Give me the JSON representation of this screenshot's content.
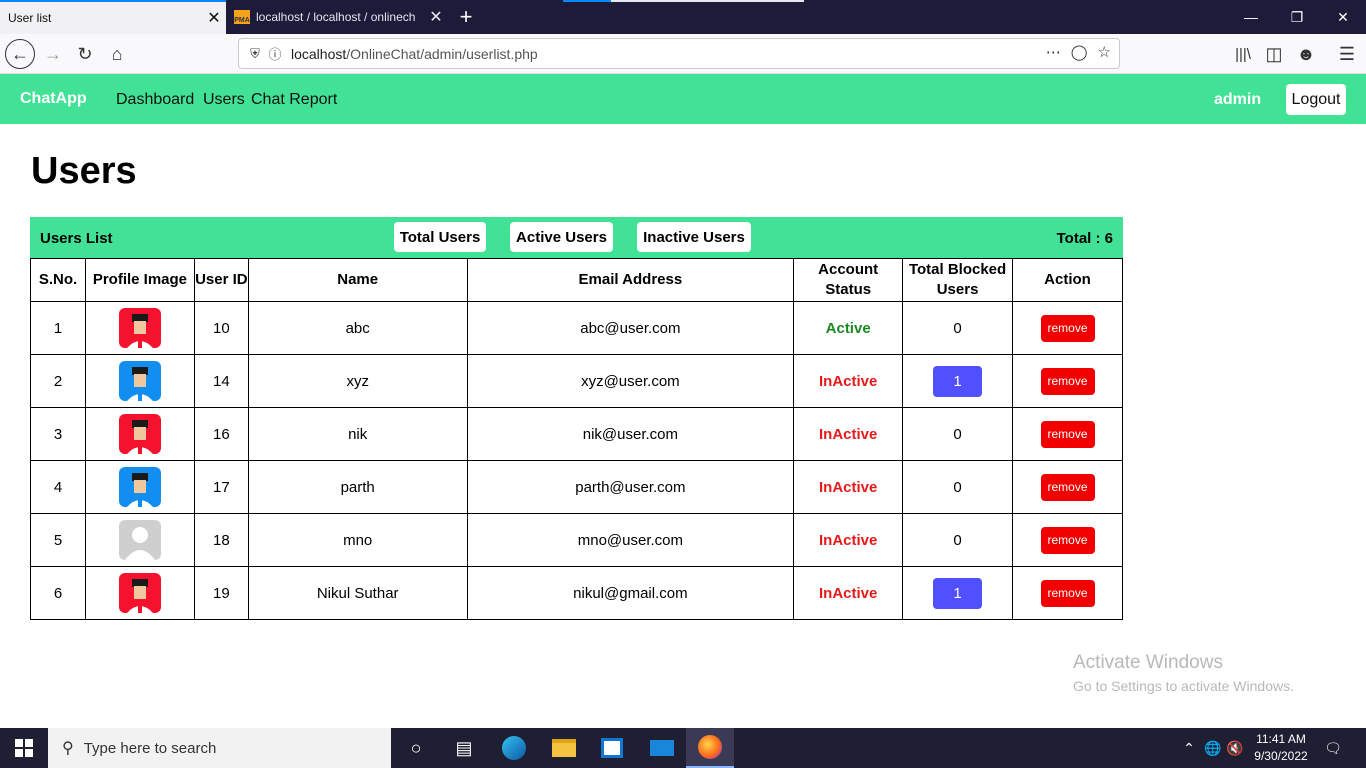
{
  "browser": {
    "tabs": [
      {
        "title": "User list",
        "active": true
      },
      {
        "title": "localhost / localhost / onlinech",
        "active": false
      }
    ],
    "url_host": "localhost",
    "url_path": "/OnlineChat/admin/userlist.php"
  },
  "nav": {
    "brand": "ChatApp",
    "links": [
      "Dashboard",
      "Users",
      "Chat Report"
    ],
    "user": "admin",
    "logout": "Logout"
  },
  "page": {
    "title": "Users",
    "list_title": "Users List",
    "filter_buttons": [
      "Total Users",
      "Active Users",
      "Inactive Users"
    ],
    "total": "Total : 6"
  },
  "table": {
    "headers": [
      "S.No.",
      "Profile Image",
      "User ID",
      "Name",
      "Email Address",
      "Account Status",
      "Total Blocked Users",
      "Action"
    ],
    "rows": [
      {
        "sno": "1",
        "avatar": "red",
        "user_id": "10",
        "name": "abc",
        "email": "abc@user.com",
        "status": "Active",
        "blocked": "0",
        "action": "remove"
      },
      {
        "sno": "2",
        "avatar": "blue",
        "user_id": "14",
        "name": "xyz",
        "email": "xyz@user.com",
        "status": "InActive",
        "blocked": "1",
        "action": "remove"
      },
      {
        "sno": "3",
        "avatar": "red",
        "user_id": "16",
        "name": "nik",
        "email": "nik@user.com",
        "status": "InActive",
        "blocked": "0",
        "action": "remove"
      },
      {
        "sno": "4",
        "avatar": "blue",
        "user_id": "17",
        "name": "parth",
        "email": "parth@user.com",
        "status": "InActive",
        "blocked": "0",
        "action": "remove"
      },
      {
        "sno": "5",
        "avatar": "default",
        "user_id": "18",
        "name": "mno",
        "email": "mno@user.com",
        "status": "InActive",
        "blocked": "0",
        "action": "remove"
      },
      {
        "sno": "6",
        "avatar": "red",
        "user_id": "19",
        "name": "Nikul Suthar",
        "email": "nikul@gmail.com",
        "status": "InActive",
        "blocked": "1",
        "action": "remove"
      }
    ]
  },
  "watermark": {
    "line1": "Activate Windows",
    "line2": "Go to Settings to activate Windows."
  },
  "taskbar": {
    "search_placeholder": "Type here to search",
    "time": "11:41 AM",
    "date": "9/30/2022"
  },
  "colors": {
    "accent_green": "#42e296",
    "active_status": "#198a23",
    "inactive_status": "#e51a1a",
    "remove_button": "#f20000",
    "blocked_badge": "#5050ff"
  }
}
